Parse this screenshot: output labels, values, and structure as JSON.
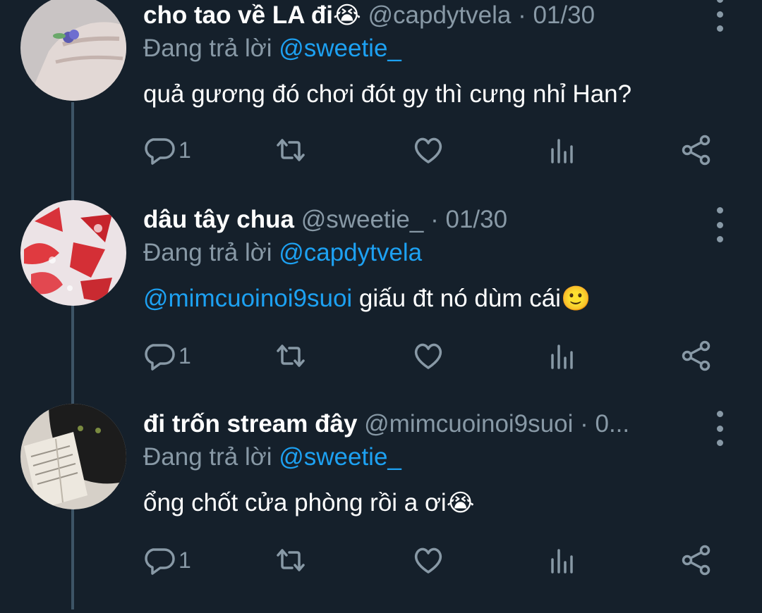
{
  "tweets": [
    {
      "name": "cho tao về LA đi",
      "name_emoji": "😭",
      "handle": "@capdytvela",
      "separator": "·",
      "date": "01/30",
      "reply_prefix": "Đang trả lời",
      "reply_to": "@sweetie_",
      "mention": "",
      "text": "quả gương đó chơi đót gy thì cưng nhỉ Han?",
      "text_emoji": "",
      "reply_count": "1",
      "avatar": "hand-ring-photo"
    },
    {
      "name": "dâu tây chua",
      "name_emoji": "",
      "handle": "@sweetie_",
      "separator": "·",
      "date": "01/30",
      "reply_prefix": "Đang trả lời",
      "reply_to": "@capdytvela",
      "mention": "@mimcuoinoi9suoi",
      "text": " giấu đt nó dùm cái",
      "text_emoji": "🙂",
      "reply_count": "1",
      "avatar": "strawberry-milk-photo"
    },
    {
      "name": "đi trốn stream đây",
      "name_emoji": "",
      "handle": "@mimcuoinoi9suoi",
      "separator": "·",
      "date": "0...",
      "reply_prefix": "Đang trả lời",
      "reply_to": "@sweetie_",
      "mention": "",
      "text": "ổng chốt cửa phòng rồi a ơi",
      "text_emoji": "😭",
      "reply_count": "1",
      "avatar": "black-cat-book-photo"
    }
  ],
  "icons": {
    "reply": "reply-icon",
    "retweet": "retweet-icon",
    "like": "like-icon",
    "analytics": "analytics-icon",
    "share": "share-icon",
    "more": "more-options-icon"
  },
  "colors": {
    "background": "#15202b",
    "secondary_text": "#8899a6",
    "link": "#1da1f2",
    "thread_line": "#3d5466"
  }
}
